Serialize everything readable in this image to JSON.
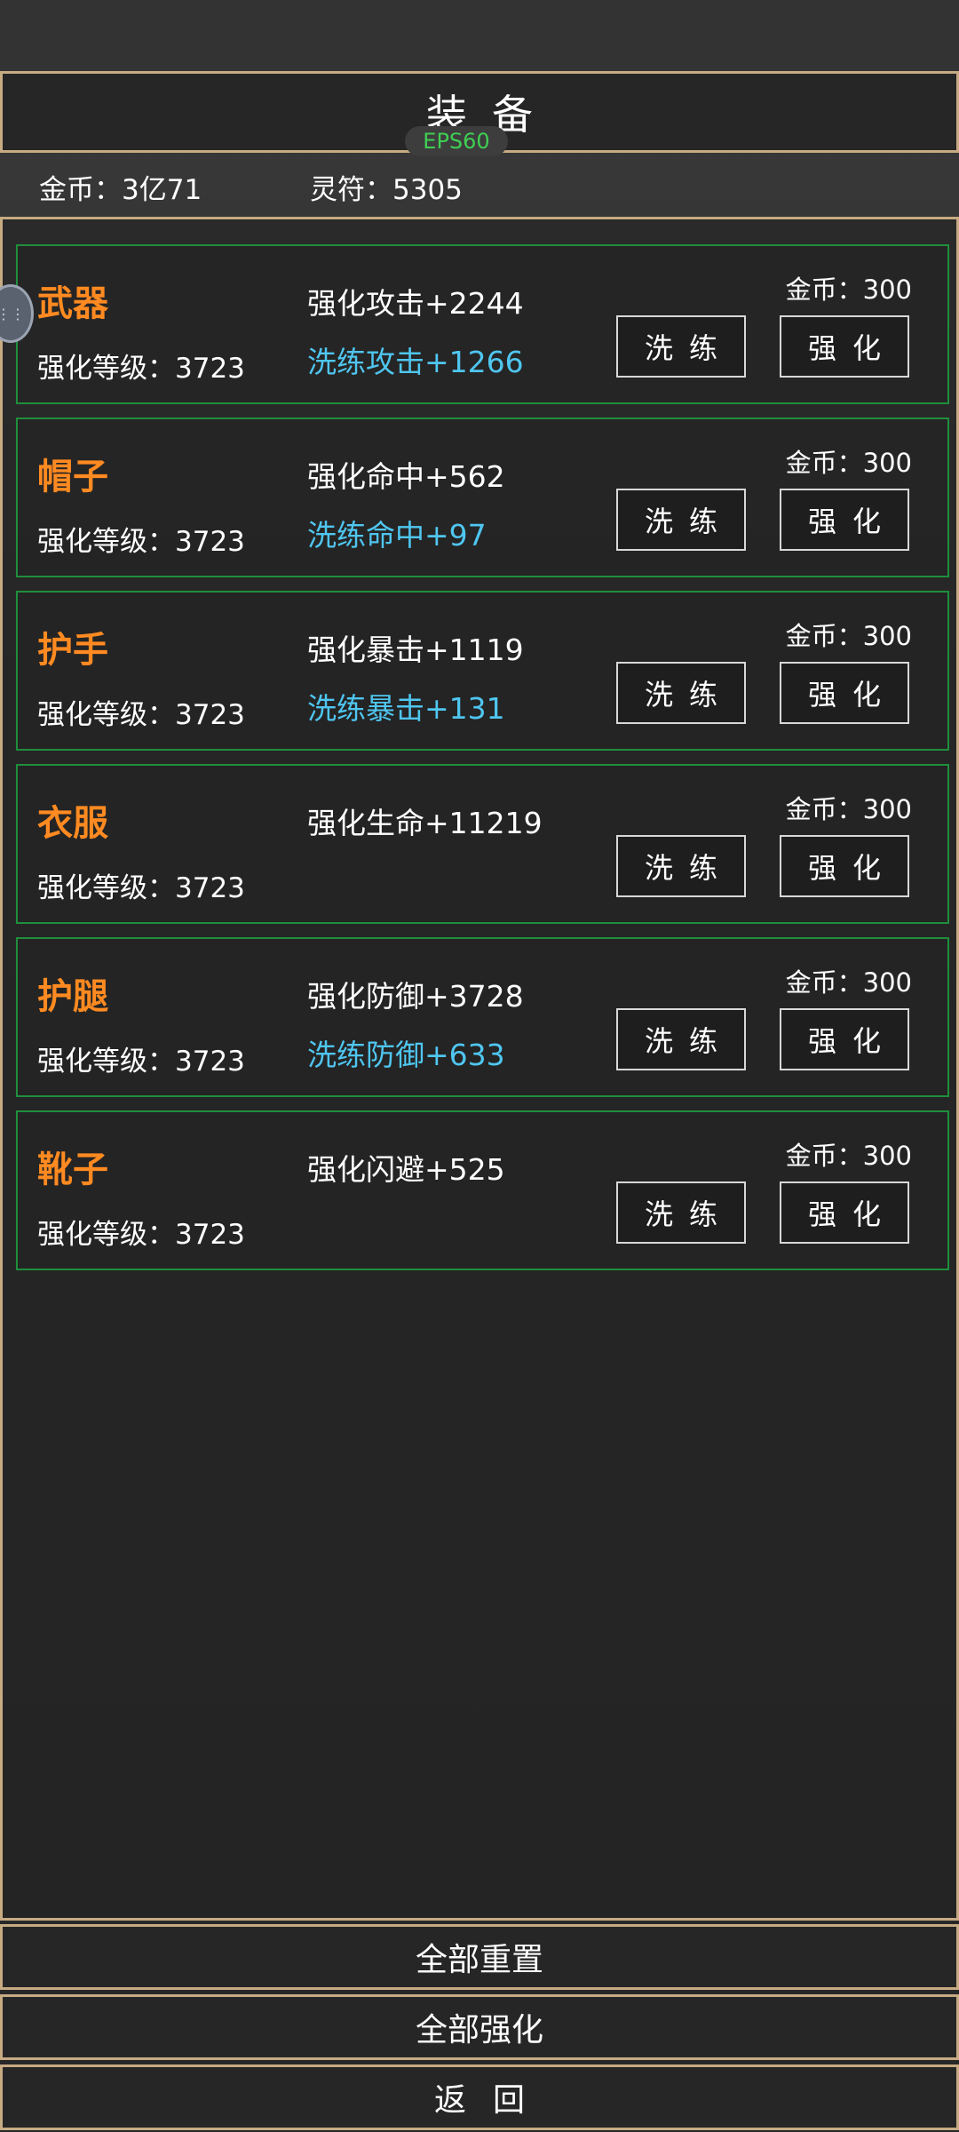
{
  "header": {
    "title": "装备",
    "fps": "EPS60"
  },
  "currency": {
    "gold": "金币：3亿71",
    "talisman": "灵符：5305"
  },
  "cards": [
    {
      "name": "武器",
      "level": "强化等级：3723",
      "stat1": "强化攻击+2244",
      "stat2": "洗练攻击+1266",
      "cost": "金币：300",
      "refine_label": "洗练",
      "enhance_label": "强化"
    },
    {
      "name": "帽子",
      "level": "强化等级：3723",
      "stat1": "强化命中+562",
      "stat2": "洗练命中+97",
      "cost": "金币：300",
      "refine_label": "洗练",
      "enhance_label": "强化"
    },
    {
      "name": "护手",
      "level": "强化等级：3723",
      "stat1": "强化暴击+1119",
      "stat2": "洗练暴击+131",
      "cost": "金币：300",
      "refine_label": "洗练",
      "enhance_label": "强化"
    },
    {
      "name": "衣服",
      "level": "强化等级：3723",
      "stat1": "强化生命+11219",
      "stat2": "",
      "cost": "金币：300",
      "refine_label": "洗练",
      "enhance_label": "强化"
    },
    {
      "name": "护腿",
      "level": "强化等级：3723",
      "stat1": "强化防御+3728",
      "stat2": "洗练防御+633",
      "cost": "金币：300",
      "refine_label": "洗练",
      "enhance_label": "强化"
    },
    {
      "name": "靴子",
      "level": "强化等级：3723",
      "stat1": "强化闪避+525",
      "stat2": "",
      "cost": "金币：300",
      "refine_label": "洗练",
      "enhance_label": "强化"
    }
  ],
  "footer": {
    "reset_all": "全部重置",
    "enhance_all": "全部强化",
    "back": "返回"
  },
  "colors": {
    "accent_border": "#c7ab83",
    "card_border": "#1f8e3c",
    "item_name": "#ff8a21",
    "refine_stat": "#4fc6f0",
    "fps": "#3fcf53"
  },
  "icons": {
    "side_handle": "floating-assist-icon"
  }
}
